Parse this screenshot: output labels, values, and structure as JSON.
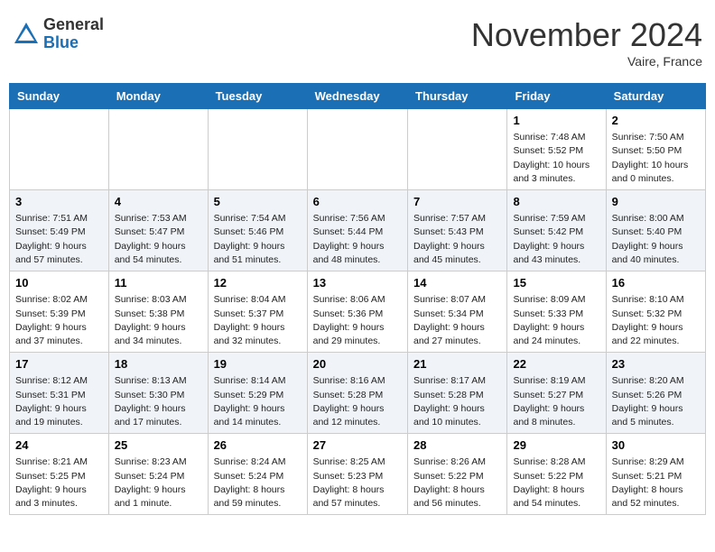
{
  "header": {
    "logo_general": "General",
    "logo_blue": "Blue",
    "month_title": "November 2024",
    "location": "Vaire, France"
  },
  "days_of_week": [
    "Sunday",
    "Monday",
    "Tuesday",
    "Wednesday",
    "Thursday",
    "Friday",
    "Saturday"
  ],
  "weeks": [
    [
      {
        "day": "",
        "info": ""
      },
      {
        "day": "",
        "info": ""
      },
      {
        "day": "",
        "info": ""
      },
      {
        "day": "",
        "info": ""
      },
      {
        "day": "",
        "info": ""
      },
      {
        "day": "1",
        "info": "Sunrise: 7:48 AM\nSunset: 5:52 PM\nDaylight: 10 hours and 3 minutes."
      },
      {
        "day": "2",
        "info": "Sunrise: 7:50 AM\nSunset: 5:50 PM\nDaylight: 10 hours and 0 minutes."
      }
    ],
    [
      {
        "day": "3",
        "info": "Sunrise: 7:51 AM\nSunset: 5:49 PM\nDaylight: 9 hours and 57 minutes."
      },
      {
        "day": "4",
        "info": "Sunrise: 7:53 AM\nSunset: 5:47 PM\nDaylight: 9 hours and 54 minutes."
      },
      {
        "day": "5",
        "info": "Sunrise: 7:54 AM\nSunset: 5:46 PM\nDaylight: 9 hours and 51 minutes."
      },
      {
        "day": "6",
        "info": "Sunrise: 7:56 AM\nSunset: 5:44 PM\nDaylight: 9 hours and 48 minutes."
      },
      {
        "day": "7",
        "info": "Sunrise: 7:57 AM\nSunset: 5:43 PM\nDaylight: 9 hours and 45 minutes."
      },
      {
        "day": "8",
        "info": "Sunrise: 7:59 AM\nSunset: 5:42 PM\nDaylight: 9 hours and 43 minutes."
      },
      {
        "day": "9",
        "info": "Sunrise: 8:00 AM\nSunset: 5:40 PM\nDaylight: 9 hours and 40 minutes."
      }
    ],
    [
      {
        "day": "10",
        "info": "Sunrise: 8:02 AM\nSunset: 5:39 PM\nDaylight: 9 hours and 37 minutes."
      },
      {
        "day": "11",
        "info": "Sunrise: 8:03 AM\nSunset: 5:38 PM\nDaylight: 9 hours and 34 minutes."
      },
      {
        "day": "12",
        "info": "Sunrise: 8:04 AM\nSunset: 5:37 PM\nDaylight: 9 hours and 32 minutes."
      },
      {
        "day": "13",
        "info": "Sunrise: 8:06 AM\nSunset: 5:36 PM\nDaylight: 9 hours and 29 minutes."
      },
      {
        "day": "14",
        "info": "Sunrise: 8:07 AM\nSunset: 5:34 PM\nDaylight: 9 hours and 27 minutes."
      },
      {
        "day": "15",
        "info": "Sunrise: 8:09 AM\nSunset: 5:33 PM\nDaylight: 9 hours and 24 minutes."
      },
      {
        "day": "16",
        "info": "Sunrise: 8:10 AM\nSunset: 5:32 PM\nDaylight: 9 hours and 22 minutes."
      }
    ],
    [
      {
        "day": "17",
        "info": "Sunrise: 8:12 AM\nSunset: 5:31 PM\nDaylight: 9 hours and 19 minutes."
      },
      {
        "day": "18",
        "info": "Sunrise: 8:13 AM\nSunset: 5:30 PM\nDaylight: 9 hours and 17 minutes."
      },
      {
        "day": "19",
        "info": "Sunrise: 8:14 AM\nSunset: 5:29 PM\nDaylight: 9 hours and 14 minutes."
      },
      {
        "day": "20",
        "info": "Sunrise: 8:16 AM\nSunset: 5:28 PM\nDaylight: 9 hours and 12 minutes."
      },
      {
        "day": "21",
        "info": "Sunrise: 8:17 AM\nSunset: 5:28 PM\nDaylight: 9 hours and 10 minutes."
      },
      {
        "day": "22",
        "info": "Sunrise: 8:19 AM\nSunset: 5:27 PM\nDaylight: 9 hours and 8 minutes."
      },
      {
        "day": "23",
        "info": "Sunrise: 8:20 AM\nSunset: 5:26 PM\nDaylight: 9 hours and 5 minutes."
      }
    ],
    [
      {
        "day": "24",
        "info": "Sunrise: 8:21 AM\nSunset: 5:25 PM\nDaylight: 9 hours and 3 minutes."
      },
      {
        "day": "25",
        "info": "Sunrise: 8:23 AM\nSunset: 5:24 PM\nDaylight: 9 hours and 1 minute."
      },
      {
        "day": "26",
        "info": "Sunrise: 8:24 AM\nSunset: 5:24 PM\nDaylight: 8 hours and 59 minutes."
      },
      {
        "day": "27",
        "info": "Sunrise: 8:25 AM\nSunset: 5:23 PM\nDaylight: 8 hours and 57 minutes."
      },
      {
        "day": "28",
        "info": "Sunrise: 8:26 AM\nSunset: 5:22 PM\nDaylight: 8 hours and 56 minutes."
      },
      {
        "day": "29",
        "info": "Sunrise: 8:28 AM\nSunset: 5:22 PM\nDaylight: 8 hours and 54 minutes."
      },
      {
        "day": "30",
        "info": "Sunrise: 8:29 AM\nSunset: 5:21 PM\nDaylight: 8 hours and 52 minutes."
      }
    ]
  ]
}
